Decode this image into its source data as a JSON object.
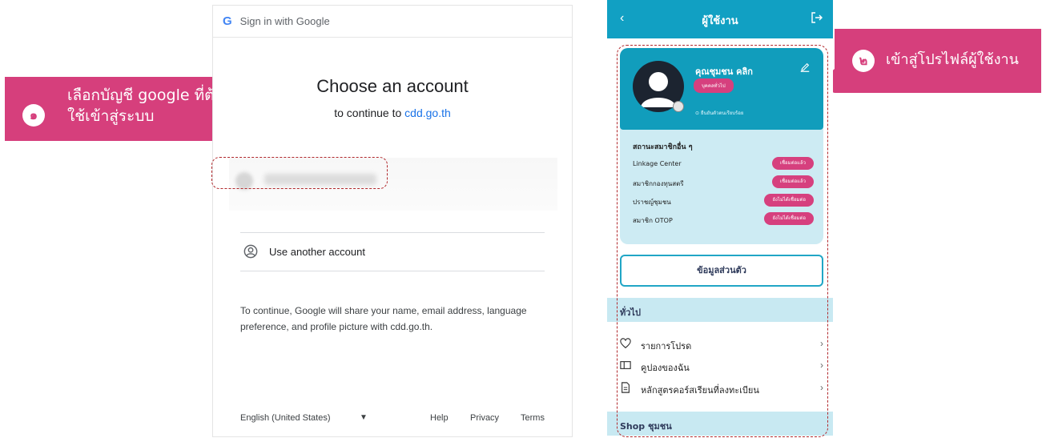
{
  "callout1": {
    "step": "๑",
    "text": "เลือกบัญชี google ที่ต้องการใช้เข้าสู่ระบบ"
  },
  "callout2": {
    "step": "๒",
    "text": "เข้าสู่โปรไฟล์ผู้ใช้งาน"
  },
  "colors": {
    "callout": "#d63f7c",
    "teal": "#11a0c3",
    "dash": "#b1282c"
  },
  "google": {
    "header": "Sign in with Google",
    "logo": "G",
    "title": "Choose an account",
    "subtitle_prefix": "to continue to",
    "subtitle_domain": "cdd.go.th",
    "use_another": "Use another account",
    "notice": "To continue, Google will share your name, email address, language preference, and profile picture with cdd.go.th.",
    "footer": {
      "language": "English (United States)",
      "help": "Help",
      "privacy": "Privacy",
      "terms": "Terms"
    }
  },
  "app": {
    "title": "ผู้ใช้งาน",
    "back": "‹",
    "profile": {
      "name": "คุณชุมชน คลิก",
      "type": "บุคคลทั่วไป",
      "verified": "ยืนยันตัวตนเรียบร้อย"
    },
    "status": {
      "heading": "สถานะสมาชิกอื่น ๆ",
      "rows": [
        {
          "name": "Linkage Center",
          "badge": "เชื่อมต่อแล้ว"
        },
        {
          "name": "สมาชิกกองทุนสตรี",
          "badge": "เชื่อมต่อแล้ว"
        },
        {
          "name": "ปราชญ์ชุมชน",
          "badge": "ยังไม่ได้เชื่อมต่อ"
        },
        {
          "name": "สมาชิก OTOP",
          "badge": "ยังไม่ได้เชื่อมต่อ"
        }
      ]
    },
    "personal_button": "ข้อมูลส่วนตัว",
    "general_section": "ทั่วไป",
    "menu": [
      {
        "label": "รายการโปรด",
        "icon": "heart-icon"
      },
      {
        "label": "คูปองของฉัน",
        "icon": "coupon-icon"
      },
      {
        "label": "หลักสูตรคอร์สเรียนที่ลงทะเบียน",
        "icon": "document-icon"
      }
    ],
    "shop_section": "Shop ชุมชน"
  }
}
